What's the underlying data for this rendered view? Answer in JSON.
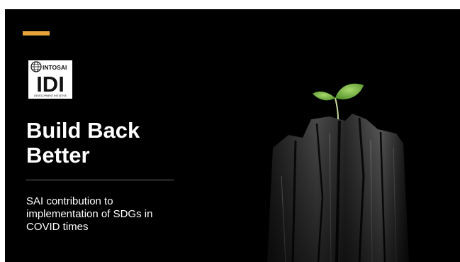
{
  "slide": {
    "background_color": "#000000",
    "accent_color": "#E8A33A",
    "logo": {
      "name": "INTOSAI",
      "mark": "IDI",
      "tagline": "DEVELOPMENT INITIATIVE"
    },
    "title_lines": [
      "Build Back",
      "Better"
    ],
    "subtitle_lines": [
      "SAI contribution to",
      "implementation of SDGs in",
      "COVID times"
    ],
    "image": {
      "icon": "charred-wood-with-sprout"
    }
  }
}
